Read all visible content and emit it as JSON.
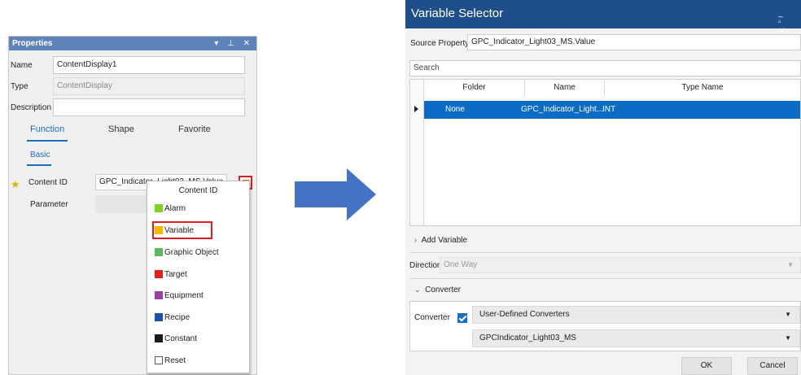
{
  "properties": {
    "title": "Properties",
    "controls": "▾ ⊥ ✕",
    "name_label": "Name",
    "name_value": "ContentDisplay1",
    "type_label": "Type",
    "type_value": "ContentDisplay",
    "description_label": "Description",
    "description_value": "",
    "tabs": [
      "Function",
      "Shape",
      "Favorite"
    ],
    "subtab": "Basic",
    "content_id_label": "Content ID",
    "content_id_value": "GPC_Indicator_Light03_MS.Value",
    "parameter_label": "Parameter"
  },
  "dropdown": {
    "header": "Content ID",
    "items": [
      {
        "label": "Alarm",
        "color": "#7ed321"
      },
      {
        "label": "Variable",
        "color": "#f5b800"
      },
      {
        "label": "Graphic Object",
        "color": "#5cb85c"
      },
      {
        "label": "Target",
        "color": "#e02020"
      },
      {
        "label": "Equipment",
        "color": "#9b3fa6"
      },
      {
        "label": "Recipe",
        "color": "#1f4fb0"
      },
      {
        "label": "Constant",
        "color": "#1a1a1a"
      },
      {
        "label": "Reset",
        "color": "#ffffff"
      }
    ]
  },
  "selector": {
    "title": "Variable Selector",
    "controls": "_ ▫ ✕",
    "source_label": "Source Property",
    "source_value": "GPC_Indicator_Light03_MS.Value",
    "search_placeholder": "Search",
    "columns": [
      "Folder",
      "Name",
      "Type Name"
    ],
    "row": {
      "folder": "None",
      "name": "GPC_Indicator_Light...",
      "type": "INT"
    },
    "add_variable": "Add Variable",
    "direction_label": "Direction",
    "direction_value": "One Way",
    "converter_section": "Converter",
    "converter_label": "Converter",
    "converter_type": "User-Defined Converters",
    "converter_name": "GPCIndicator_Light03_MS",
    "ok": "OK",
    "cancel": "Cancel"
  }
}
